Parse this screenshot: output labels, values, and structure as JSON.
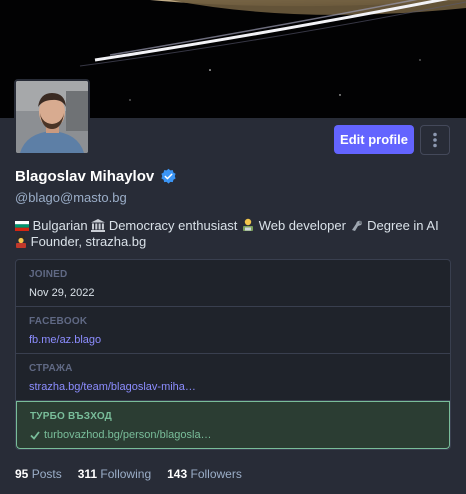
{
  "profile": {
    "display_name": "Blagoslav Mihaylov",
    "handle": "@blago@masto.bg",
    "bio_parts": [
      "Bulgarian",
      "Democracy enthusiast",
      "Web developer",
      "Degree in AI",
      "Founder, strazha.bg"
    ]
  },
  "buttons": {
    "edit_profile": "Edit profile"
  },
  "fields": [
    {
      "label": "JOINED",
      "value": "Nov 29, 2022"
    },
    {
      "label": "FACEBOOK",
      "value": "fb.me/az.blago"
    },
    {
      "label": "СТРАЖА",
      "value": "strazha.bg/team/blagoslav-miha…"
    },
    {
      "label": "ТУРБО ВЪЗХОД",
      "value": "turbovazhod.bg/person/blagosla…"
    }
  ],
  "stats": {
    "posts_count": "95",
    "posts_label": "Posts",
    "following_count": "311",
    "following_label": "Following",
    "followers_count": "143",
    "followers_label": "Followers"
  },
  "icons": {
    "verified": "verified-badge-icon",
    "more": "kebab-menu-icon",
    "check": "check-icon"
  },
  "colors": {
    "accent": "#6364ff",
    "verified_green": "#79bd9a",
    "link": "#8c8dff",
    "background": "#282c37"
  }
}
